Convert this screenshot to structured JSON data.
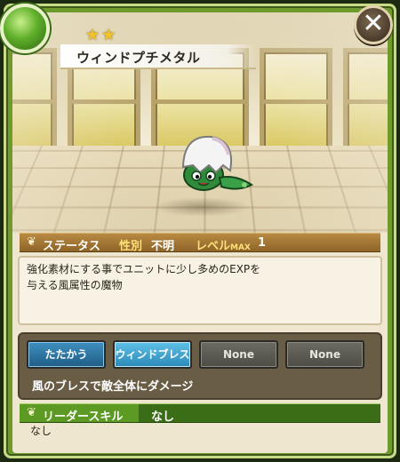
{
  "title": {
    "name": "ウィンドプチメタル",
    "stars": "★★"
  },
  "close_label": "✕",
  "status": {
    "section_label": "ステータス",
    "gender_key": "性別",
    "gender_value": "不明",
    "level_key": "レベル",
    "level_key_sub": "MAX",
    "level_value": "1"
  },
  "description": {
    "line1": "強化素材にする事でユニットに少し多めのEXPを",
    "line2": "与える風属性の魔物"
  },
  "skills": {
    "buttons": [
      {
        "label": "たたかう"
      },
      {
        "label": "ウィンドブレス"
      },
      {
        "label": "None"
      },
      {
        "label": "None"
      }
    ],
    "selected_description": "風のブレスで敵全体にダメージ"
  },
  "leader_skill": {
    "label": "リーダースキル",
    "value": "なし",
    "detail": "なし"
  },
  "colors": {
    "frame_green": "#6f9a2c",
    "status_bar": "#8e6428",
    "skill_active": "#2c89b8",
    "leader_bar": "#5c9a24"
  }
}
